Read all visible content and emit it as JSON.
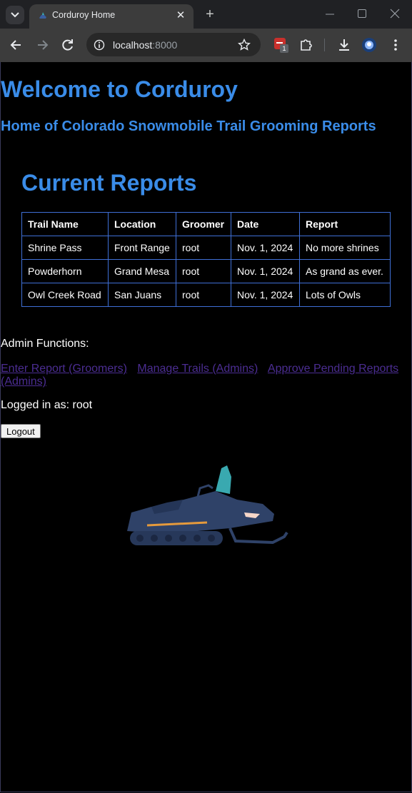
{
  "browser": {
    "tab_title": "Corduroy Home",
    "url_host": "localhost",
    "url_port": ":8000",
    "extension_badge": "1"
  },
  "page": {
    "title": "Welcome to Corduroy",
    "subtitle": "Home of Colorado Snowmobile Trail Grooming Reports",
    "reports_heading": "Current Reports",
    "table": {
      "headers": [
        "Trail Name",
        "Location",
        "Groomer",
        "Date",
        "Report"
      ],
      "rows": [
        [
          "Shrine Pass",
          "Front Range",
          "root",
          "Nov. 1, 2024",
          "No more shrines"
        ],
        [
          "Powderhorn",
          "Grand Mesa",
          "root",
          "Nov. 1, 2024",
          "As grand as ever."
        ],
        [
          "Owl Creek Road",
          "San Juans",
          "root",
          "Nov. 1, 2024",
          "Lots of Owls"
        ]
      ]
    },
    "admin_label": "Admin Functions:",
    "links": {
      "enter_report": "Enter Report (Groomers)",
      "manage_trails": "Manage Trails (Admins)",
      "approve_reports": "Approve Pending Reports (Admins)"
    },
    "logged_in": "Logged in as: root",
    "logout_label": "Logout"
  },
  "colors": {
    "heading": "#3a8ce8",
    "link_visited": "#4b2d92",
    "table_border": "#3f6fd6",
    "background": "#000000"
  }
}
